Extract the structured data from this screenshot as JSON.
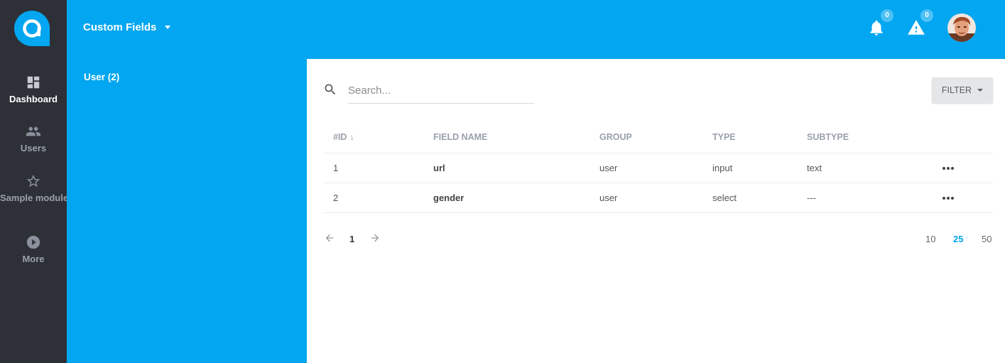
{
  "rail": {
    "items": [
      {
        "label": "Dashboard",
        "icon": "dashboard-icon",
        "active": true
      },
      {
        "label": "Users",
        "icon": "users-icon",
        "active": false
      },
      {
        "label": "Sample module",
        "icon": "star-icon",
        "active": false
      },
      {
        "label": "More",
        "icon": "play-circle-icon",
        "active": false
      }
    ]
  },
  "header": {
    "title": "Custom Fields",
    "notifications_count": "0",
    "alerts_count": "0"
  },
  "subnav": {
    "items": [
      {
        "label": "User (2)"
      }
    ]
  },
  "search": {
    "placeholder": "Search...",
    "value": ""
  },
  "filter": {
    "label": "FILTER"
  },
  "table": {
    "columns": [
      "#ID",
      "FIELD NAME",
      "GROUP",
      "TYPE",
      "SUBTYPE"
    ],
    "sort_arrow": "↓",
    "rows": [
      {
        "id": "1",
        "field_name": "url",
        "group": "user",
        "type": "input",
        "subtype": "text"
      },
      {
        "id": "2",
        "field_name": "gender",
        "group": "user",
        "type": "select",
        "subtype": "---"
      }
    ]
  },
  "pagination": {
    "current_page": "1",
    "per_page_options": [
      "10",
      "25",
      "50"
    ],
    "per_page_selected": "25"
  },
  "colors": {
    "primary": "#03a6f0",
    "rail": "#2d3037",
    "badge": "#4dc1f5"
  }
}
